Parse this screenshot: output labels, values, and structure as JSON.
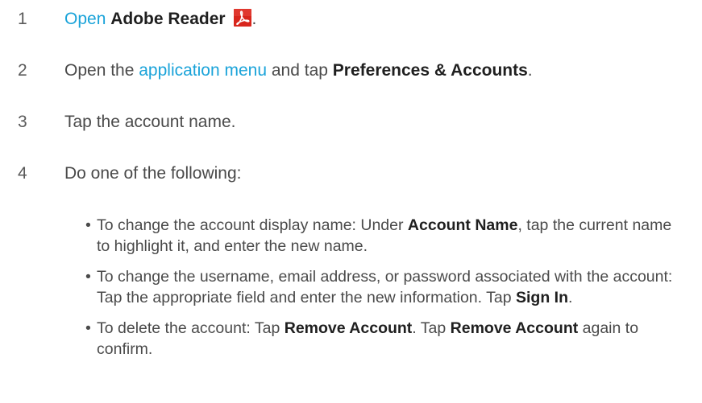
{
  "steps": [
    {
      "num": "1",
      "open": "Open",
      "app": "Adobe Reader",
      "end": "."
    },
    {
      "num": "2",
      "pre": "Open the",
      "link": "application menu",
      "mid": "and tap",
      "bold": "Preferences & Accounts",
      "end": "."
    },
    {
      "num": "3",
      "text": "Tap the account name."
    },
    {
      "num": "4",
      "text": "Do one of the following:"
    }
  ],
  "bullets": [
    {
      "pre": "To change the account display name: Under",
      "bold1": "Account Name",
      "post": ", tap the current name to highlight it, and enter the new name."
    },
    {
      "pre": "To change the username, email address, or password associated with the account: Tap the appropriate field and enter the new information. Tap",
      "bold1": "Sign In",
      "post": "."
    },
    {
      "pre": "To delete the account: Tap",
      "bold1": "Remove Account",
      "mid": ". Tap",
      "bold2": "Remove Account",
      "post": "again to confirm."
    }
  ],
  "icons": {
    "app_icon": "adobe-reader-icon",
    "icon_color": "#d8261d"
  }
}
